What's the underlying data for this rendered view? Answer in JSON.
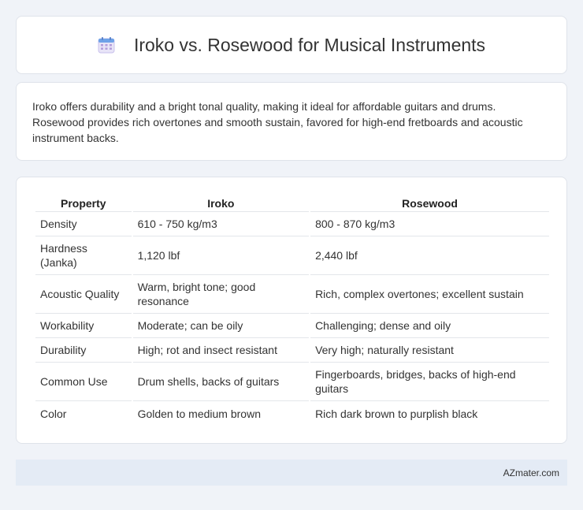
{
  "header": {
    "icon": "calendar-icon",
    "title": "Iroko vs. Rosewood for Musical Instruments"
  },
  "intro": {
    "text": "Iroko offers durability and a bright tonal quality, making it ideal for affordable guitars and drums. Rosewood provides rich overtones and smooth sustain, favored for high-end fretboards and acoustic instrument backs."
  },
  "table": {
    "headers": [
      "Property",
      "Iroko",
      "Rosewood"
    ],
    "rows": [
      [
        "Density",
        "610 - 750 kg/m3",
        "800 - 870 kg/m3"
      ],
      [
        "Hardness (Janka)",
        "1,120 lbf",
        "2,440 lbf"
      ],
      [
        "Acoustic Quality",
        "Warm, bright tone; good resonance",
        "Rich, complex overtones; excellent sustain"
      ],
      [
        "Workability",
        "Moderate; can be oily",
        "Challenging; dense and oily"
      ],
      [
        "Durability",
        "High; rot and insect resistant",
        "Very high; naturally resistant"
      ],
      [
        "Common Use",
        "Drum shells, backs of guitars",
        "Fingerboards, bridges, backs of high-end guitars"
      ],
      [
        "Color",
        "Golden to medium brown",
        "Rich dark brown to purplish black"
      ]
    ]
  },
  "footer": {
    "site": "AZmater.com"
  }
}
